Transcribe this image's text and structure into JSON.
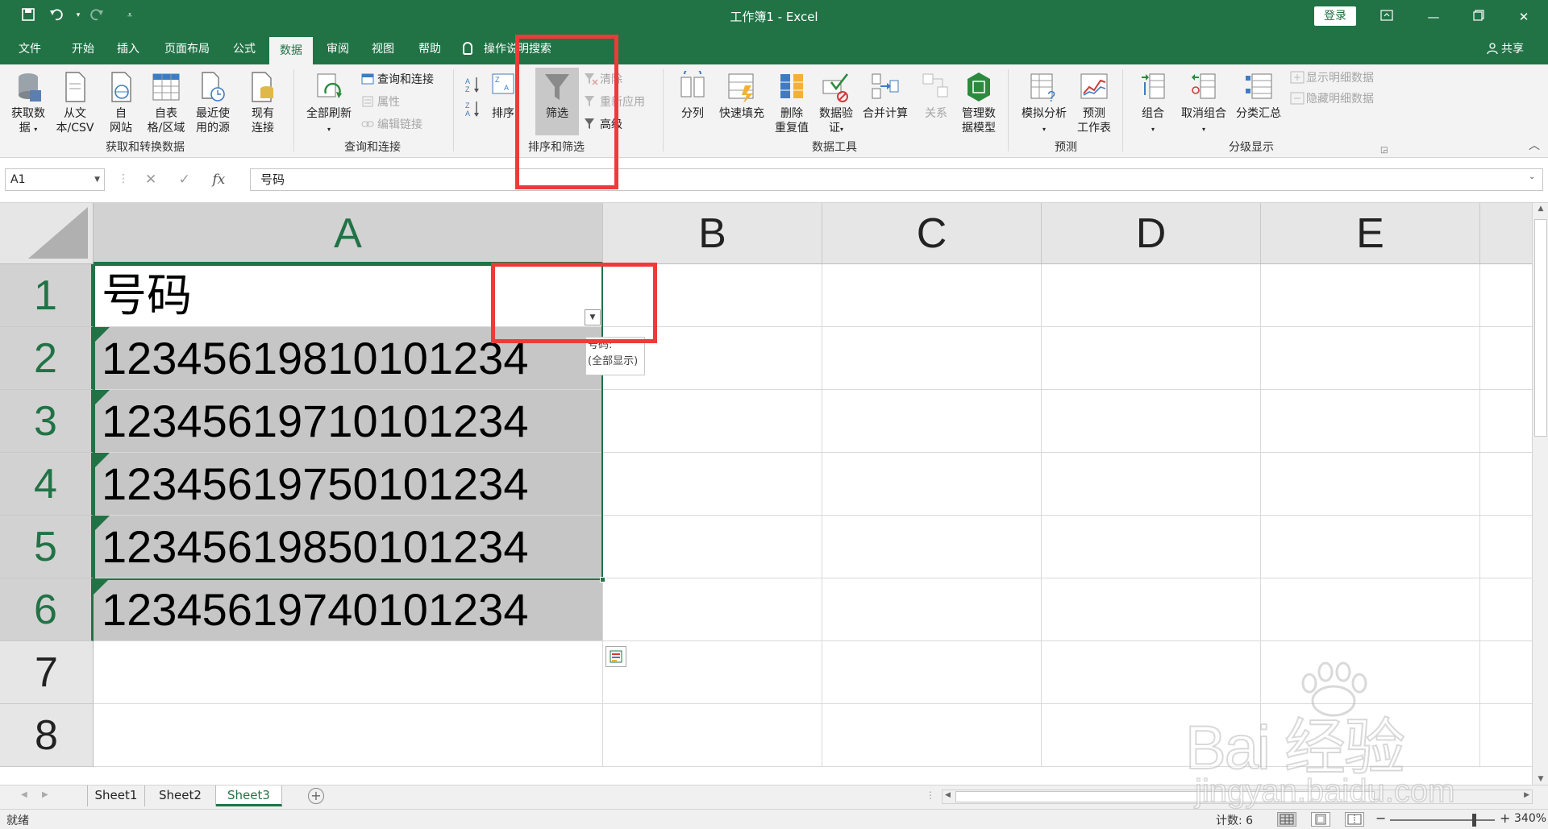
{
  "titlebar": {
    "title": "工作簿1  -  Excel",
    "login_label": "登录",
    "icons": [
      "save-icon",
      "undo-icon",
      "redo-icon",
      "customize-icon",
      "ribbon-display-icon",
      "minimize-icon",
      "restore-icon",
      "close-icon"
    ]
  },
  "tabs": [
    {
      "label": "文件"
    },
    {
      "label": "开始"
    },
    {
      "label": "插入"
    },
    {
      "label": "页面布局"
    },
    {
      "label": "公式"
    },
    {
      "label": "数据"
    },
    {
      "label": "审阅"
    },
    {
      "label": "视图"
    },
    {
      "label": "帮助"
    }
  ],
  "tellme": {
    "label": "操作说明搜索"
  },
  "share_label": "共享",
  "ribbon": {
    "get_data": {
      "get_data_1": "获取数",
      "get_data_2": "据",
      "from_csv_1": "从文",
      "from_csv_2": "本/CSV",
      "from_web_1": "自",
      "from_web_2": "网站",
      "from_table_1": "自表",
      "from_table_2": "格/区域",
      "recent_1": "最近使",
      "recent_2": "用的源",
      "existing_1": "现有",
      "existing_2": "连接",
      "group_label": "获取和转换数据"
    },
    "queries": {
      "refresh_all_1": "全部刷新",
      "queries_connections": "查询和连接",
      "properties": "属性",
      "edit_links": "编辑链接",
      "group_label": "查询和连接"
    },
    "sort_filter": {
      "sort": "排序",
      "filter": "筛选",
      "clear": "清除",
      "reapply": "重新应用",
      "advanced": "高级",
      "group_label": "排序和筛选"
    },
    "data_tools": {
      "text_to_columns": "分列",
      "flash_fill": "快速填充",
      "remove_dup_1": "删除",
      "remove_dup_2": "重复值",
      "validation_1": "数据验",
      "validation_2": "证",
      "consolidate": "合并计算",
      "relationships": "关系",
      "data_model_1": "管理数",
      "data_model_2": "据模型",
      "group_label": "数据工具"
    },
    "forecast": {
      "whatif": "模拟分析",
      "sheet_1": "预测",
      "sheet_2": "工作表",
      "group_label": "预测"
    },
    "outline": {
      "group": "组合",
      "ungroup": "取消组合",
      "subtotal": "分类汇总",
      "show_detail": "显示明细数据",
      "hide_detail": "隐藏明细数据",
      "group_label": "分级显示"
    }
  },
  "formula_bar": {
    "name_box": "A1",
    "fx": "fx",
    "content": "号码"
  },
  "columns": [
    "A",
    "B",
    "C",
    "D",
    "E"
  ],
  "rows": [
    "1",
    "2",
    "3",
    "4",
    "5",
    "6",
    "7",
    "8"
  ],
  "cells": {
    "A1": "号码",
    "A2": "12345619810101234",
    "A3": "12345619710101234",
    "A4": "12345619750101234",
    "A5": "12345619850101234",
    "A6": "12345619740101234"
  },
  "filter_tooltip": {
    "line1": "号码:",
    "line2": "(全部显示)"
  },
  "sheets": [
    {
      "name": "Sheet1"
    },
    {
      "name": "Sheet2"
    },
    {
      "name": "Sheet3"
    }
  ],
  "status": {
    "ready": "就绪",
    "count": "计数: 6",
    "zoom": "340%"
  },
  "watermark": {
    "line1": "Bai 经验",
    "line2": "jingyan.baidu.com"
  },
  "colors": {
    "excel_green": "#217346",
    "highlight_red": "#ee3a3a"
  }
}
